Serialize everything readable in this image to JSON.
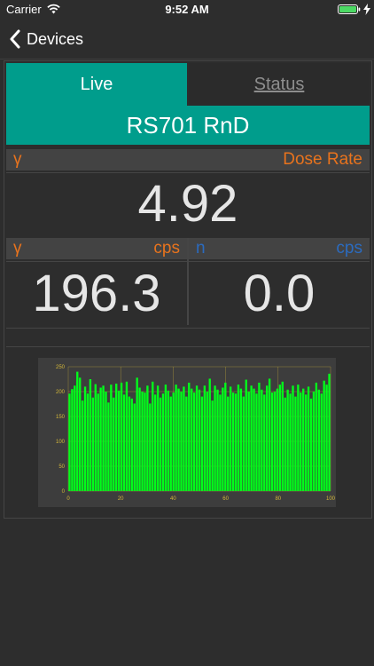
{
  "status_bar": {
    "carrier": "Carrier",
    "time": "9:52 AM"
  },
  "nav": {
    "back_label": "Devices"
  },
  "tabs": {
    "live": "Live",
    "status": "Status"
  },
  "device": {
    "name": "RS701 RnD"
  },
  "dose": {
    "symbol": "γ",
    "label": "Dose Rate",
    "value": "4.92"
  },
  "gamma": {
    "symbol": "γ",
    "unit": "cps",
    "value": "196.3"
  },
  "neutron": {
    "symbol": "n",
    "unit": "cps",
    "value": "0.0"
  },
  "colors": {
    "teal": "#009d8c",
    "orange": "#e8731d",
    "blue": "#2b6bbf",
    "bar": "#00ff1a",
    "axis": "#d4b83a"
  },
  "chart_data": {
    "type": "bar",
    "x": [
      0,
      1,
      2,
      3,
      4,
      5,
      6,
      7,
      8,
      9,
      10,
      11,
      12,
      13,
      14,
      15,
      16,
      17,
      18,
      19,
      20,
      21,
      22,
      23,
      24,
      25,
      26,
      27,
      28,
      29,
      30,
      31,
      32,
      33,
      34,
      35,
      36,
      37,
      38,
      39,
      40,
      41,
      42,
      43,
      44,
      45,
      46,
      47,
      48,
      49,
      50,
      51,
      52,
      53,
      54,
      55,
      56,
      57,
      58,
      59,
      60,
      61,
      62,
      63,
      64,
      65,
      66,
      67,
      68,
      69,
      70,
      71,
      72,
      73,
      74,
      75,
      76,
      77,
      78,
      79,
      80,
      81,
      82,
      83,
      84,
      85,
      86,
      87,
      88,
      89,
      90,
      91,
      92,
      93,
      94,
      95,
      96,
      97,
      98,
      99,
      100
    ],
    "values": [
      196,
      205,
      212,
      240,
      228,
      182,
      210,
      196,
      225,
      188,
      215,
      196,
      208,
      212,
      200,
      178,
      214,
      188,
      216,
      202,
      218,
      194,
      220,
      190,
      186,
      176,
      228,
      208,
      200,
      198,
      212,
      176,
      220,
      194,
      212,
      188,
      196,
      214,
      202,
      190,
      198,
      214,
      206,
      200,
      210,
      190,
      218,
      206,
      198,
      212,
      204,
      190,
      212,
      200,
      226,
      182,
      212,
      204,
      194,
      208,
      218,
      190,
      210,
      198,
      196,
      214,
      206,
      190,
      224,
      200,
      212,
      206,
      196,
      218,
      204,
      194,
      212,
      226,
      198,
      200,
      206,
      214,
      220,
      188,
      204,
      196,
      212,
      190,
      214,
      198,
      206,
      194,
      210,
      186,
      200,
      218,
      204,
      196,
      222,
      214,
      236
    ],
    "xlim": [
      0,
      100
    ],
    "ylim": [
      0,
      250
    ],
    "xticks": [
      0,
      20,
      40,
      60,
      80,
      100
    ],
    "yticks": [
      0,
      50,
      100,
      150,
      200,
      250
    ],
    "xlabel": "",
    "ylabel": ""
  }
}
